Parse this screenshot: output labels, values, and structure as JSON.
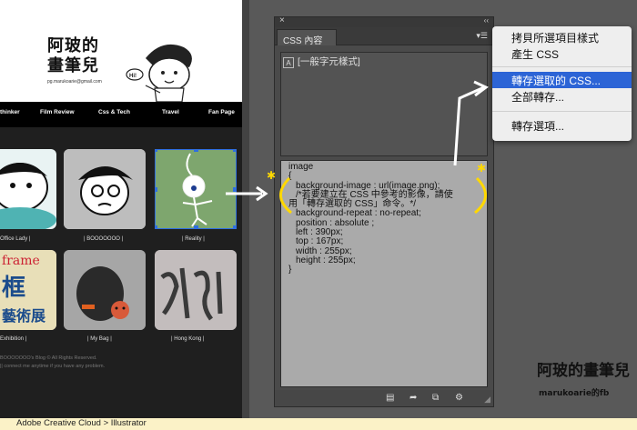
{
  "blog": {
    "title": "阿玻的畫筆兒",
    "email": "pg.marukoarie@gmail.com",
    "mascot_speech": "Hi!",
    "nav": [
      "thinker",
      "Film Review",
      "Css & Tech",
      "Travel",
      "Fan Page"
    ],
    "thumbs_row1": [
      "Office Lady |",
      "| BOOOOOOO |",
      "| Reality |"
    ],
    "thumbs_row2": [
      "Exhibition |",
      "| My Bag |",
      "| Hong Kong |"
    ],
    "thumb_texts": {
      "frame": "frame",
      "art_big": "框",
      "art_sub": "藝術展"
    },
    "footer_lines": [
      "BOOOOOOO's Blog © All Rights Reserved.",
      "|| connect me anytime if you have any problem."
    ]
  },
  "panel": {
    "tab_label": "CSS 內容",
    "style_row_label": "[一般字元樣式]",
    "code_lines": [
      "image",
      "{",
      "  background-image : url(image.png);",
      "  /*若要建立在 CSS 中參考的影像，請使",
      "用「轉存選取的 CSS」命令。*/",
      "  background-repeat : no-repeat;",
      "  position : absolute ;",
      "  left : 390px;",
      "  top : 167px;",
      "  width : 255px;",
      "  height : 255px;",
      "}"
    ]
  },
  "menu": {
    "items": [
      "拷貝所選項目樣式",
      "產生 CSS",
      "轉存選取的 CSS...",
      "全部轉存...",
      "轉存選項..."
    ],
    "active_index": 2
  },
  "status": {
    "text": "Adobe Creative Cloud > Illustrator"
  },
  "watermark": {
    "title": "阿玻的畫筆兒",
    "subtitle": "marukoarie的fb"
  },
  "colors": {
    "accent": "#2c64d6",
    "annotation": "#ffd800",
    "panel_bg": "#4a4a4a",
    "selection": "#2f6fe0"
  }
}
